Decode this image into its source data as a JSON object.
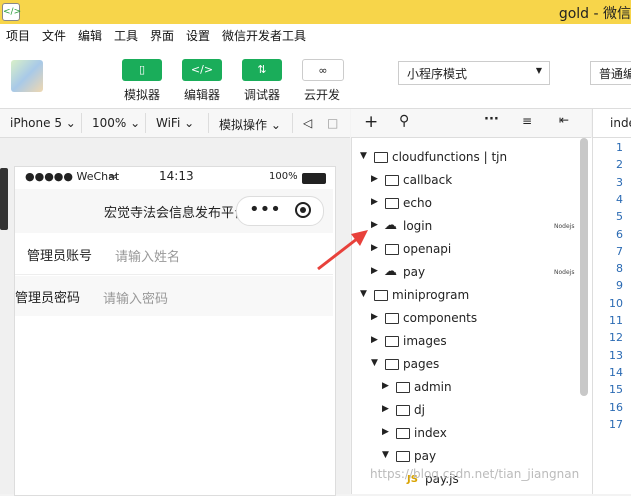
{
  "window": {
    "title": "gold - 微信"
  },
  "menu": [
    "项目",
    "文件",
    "编辑",
    "工具",
    "界面",
    "设置",
    "微信开发者工具"
  ],
  "toolbar": {
    "buttons": [
      {
        "label": "模拟器",
        "icon": "phone-icon"
      },
      {
        "label": "编辑器",
        "icon": "code-icon"
      },
      {
        "label": "调试器",
        "icon": "debug-icon"
      },
      {
        "label": "云开发",
        "icon": "cloud-link-icon"
      }
    ],
    "mode": "小程序模式",
    "compile": "普通编"
  },
  "device_bar": {
    "device": "iPhone 5",
    "zoom": "100%",
    "network": "WiFi",
    "action": "模拟操作"
  },
  "phone": {
    "signal": "●●●●● WeChat",
    "time": "14:13",
    "battery": "100%",
    "nav_title": "宏觉寺法会信息发布平台",
    "capsule_dots": "•••",
    "fields": [
      {
        "label": "管理员账号",
        "placeholder": "请输入姓名"
      },
      {
        "label": "管理员密码",
        "placeholder": "请输入密码"
      }
    ]
  },
  "tree": {
    "items": [
      {
        "label": "cloudfunctions | tjn",
        "open": true,
        "badge": ""
      },
      {
        "label": "callback",
        "open": false,
        "badge": ""
      },
      {
        "label": "echo",
        "open": false,
        "badge": ""
      },
      {
        "label": "login",
        "open": false,
        "badge": "Nodejs"
      },
      {
        "label": "openapi",
        "open": false,
        "badge": ""
      },
      {
        "label": "pay",
        "open": false,
        "badge": "Nodejs"
      },
      {
        "label": "miniprogram",
        "open": true,
        "badge": ""
      },
      {
        "label": "components",
        "open": false,
        "badge": ""
      },
      {
        "label": "images",
        "open": false,
        "badge": ""
      },
      {
        "label": "pages",
        "open": true,
        "badge": ""
      },
      {
        "label": "admin",
        "open": false,
        "badge": ""
      },
      {
        "label": "dj",
        "open": false,
        "badge": ""
      },
      {
        "label": "index",
        "open": false,
        "badge": ""
      },
      {
        "label": "pay",
        "open": true,
        "badge": ""
      },
      {
        "label": "pay.js",
        "open": false,
        "badge": ""
      }
    ],
    "file_badge": "JS"
  },
  "editor": {
    "tab": "inde",
    "line_numbers": [
      "1",
      "2",
      "3",
      "4",
      "5",
      "6",
      "7",
      "8",
      "9",
      "10",
      "11",
      "12",
      "13",
      "14",
      "15",
      "16",
      "17"
    ]
  },
  "watermark": "https://blog.csdn.net/tian_jiangnan",
  "colors": {
    "title_bar": "#f7d54a",
    "primary_button": "#1aad5a",
    "arrow": "#e8413b"
  }
}
